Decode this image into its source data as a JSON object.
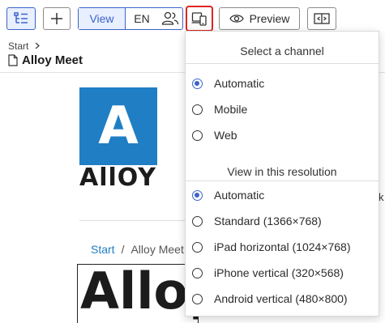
{
  "toolbar": {
    "view_label": "View",
    "language": "EN",
    "preview_label": "Preview"
  },
  "header": {
    "breadcrumb": "Start",
    "title": "Alloy Meet"
  },
  "content": {
    "logo_letter": "A",
    "logo_word": "AllOY",
    "crumb_start": "Start",
    "crumb_sep": "/",
    "crumb_current": "Alloy Meet",
    "heading_fragment": "Alloy",
    "peek_text": "k"
  },
  "dropdown": {
    "channel_heading": "Select a channel",
    "channels": [
      {
        "label": "Automatic",
        "selected": true
      },
      {
        "label": "Mobile",
        "selected": false
      },
      {
        "label": "Web",
        "selected": false
      }
    ],
    "resolution_heading": "View in this resolution",
    "resolutions": [
      {
        "label": "Automatic",
        "selected": true
      },
      {
        "label": "Standard (1366×768)",
        "selected": false
      },
      {
        "label": "iPad horizontal (1024×768)",
        "selected": false
      },
      {
        "label": "iPhone vertical (320×568)",
        "selected": false
      },
      {
        "label": "Android vertical (480×800)",
        "selected": false
      }
    ]
  },
  "colors": {
    "accent": "#3b64c9",
    "highlight_border": "#e02424",
    "logo_blue": "#1f7ec4"
  },
  "icons": [
    "tree-view-icon",
    "plus-icon",
    "people-icon",
    "device-icon",
    "eye-icon",
    "resize-icon",
    "chevron-right-icon",
    "page-icon"
  ]
}
